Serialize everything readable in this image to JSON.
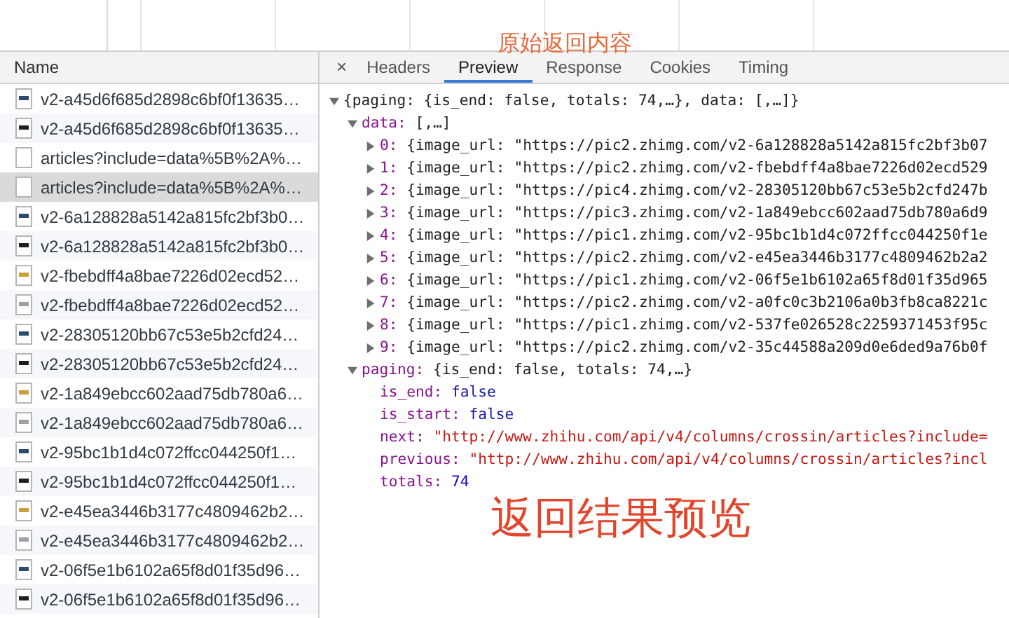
{
  "requests_header": "Name",
  "requests": [
    {
      "name": "v2-a45d6f685d2898c6bf0f13635…",
      "kind": "image",
      "selected": false
    },
    {
      "name": "v2-a45d6f685d2898c6bf0f13635…",
      "kind": "image",
      "selected": false
    },
    {
      "name": "articles?include=data%5B%2A%…",
      "kind": "document",
      "selected": false
    },
    {
      "name": "articles?include=data%5B%2A%…",
      "kind": "document",
      "selected": true
    },
    {
      "name": "v2-6a128828a5142a815fc2bf3b0…",
      "kind": "image",
      "selected": false
    },
    {
      "name": "v2-6a128828a5142a815fc2bf3b0…",
      "kind": "image",
      "selected": false
    },
    {
      "name": "v2-fbebdff4a8bae7226d02ecd52…",
      "kind": "image",
      "selected": false
    },
    {
      "name": "v2-fbebdff4a8bae7226d02ecd52…",
      "kind": "image",
      "selected": false
    },
    {
      "name": "v2-28305120bb67c53e5b2cfd24…",
      "kind": "image",
      "selected": false
    },
    {
      "name": "v2-28305120bb67c53e5b2cfd24…",
      "kind": "image",
      "selected": false
    },
    {
      "name": "v2-1a849ebcc602aad75db780a6…",
      "kind": "image",
      "selected": false
    },
    {
      "name": "v2-1a849ebcc602aad75db780a6…",
      "kind": "image",
      "selected": false
    },
    {
      "name": "v2-95bc1b1d4c072ffcc044250f1…",
      "kind": "image",
      "selected": false
    },
    {
      "name": "v2-95bc1b1d4c072ffcc044250f1…",
      "kind": "image",
      "selected": false
    },
    {
      "name": "v2-e45ea3446b3177c4809462b2…",
      "kind": "image",
      "selected": false
    },
    {
      "name": "v2-e45ea3446b3177c4809462b2…",
      "kind": "image",
      "selected": false
    },
    {
      "name": "v2-06f5e1b6102a65f8d01f35d96…",
      "kind": "image",
      "selected": false
    },
    {
      "name": "v2-06f5e1b6102a65f8d01f35d96…",
      "kind": "image",
      "selected": false
    }
  ],
  "close_tab": "×",
  "tabs": [
    {
      "label": "Headers",
      "selected": false
    },
    {
      "label": "Preview",
      "selected": true
    },
    {
      "label": "Response",
      "selected": false
    },
    {
      "label": "Cookies",
      "selected": false
    },
    {
      "label": "Timing",
      "selected": false
    }
  ],
  "preview": {
    "summary": "{paging: {is_end: false, totals: 74,…}, data: [,…]}",
    "expanded": true,
    "children": [
      {
        "key": "data:",
        "summary": "[,…]",
        "expanded": true,
        "children": [
          {
            "key": "0:",
            "summary": "{image_url: \"https://pic2.zhimg.com/v2-6a128828a5142a815fc2bf3b07",
            "expanded": false
          },
          {
            "key": "1:",
            "summary": "{image_url: \"https://pic2.zhimg.com/v2-fbebdff4a8bae7226d02ecd529",
            "expanded": false
          },
          {
            "key": "2:",
            "summary": "{image_url: \"https://pic4.zhimg.com/v2-28305120bb67c53e5b2cfd247b",
            "expanded": false
          },
          {
            "key": "3:",
            "summary": "{image_url: \"https://pic3.zhimg.com/v2-1a849ebcc602aad75db780a6d9",
            "expanded": false
          },
          {
            "key": "4:",
            "summary": "{image_url: \"https://pic1.zhimg.com/v2-95bc1b1d4c072ffcc044250f1e",
            "expanded": false
          },
          {
            "key": "5:",
            "summary": "{image_url: \"https://pic2.zhimg.com/v2-e45ea3446b3177c4809462b2a2",
            "expanded": false
          },
          {
            "key": "6:",
            "summary": "{image_url: \"https://pic1.zhimg.com/v2-06f5e1b6102a65f8d01f35d965",
            "expanded": false
          },
          {
            "key": "7:",
            "summary": "{image_url: \"https://pic2.zhimg.com/v2-a0fc0c3b2106a0b3fb8ca8221c",
            "expanded": false
          },
          {
            "key": "8:",
            "summary": "{image_url: \"https://pic1.zhimg.com/v2-537fe026528c2259371453f95c",
            "expanded": false
          },
          {
            "key": "9:",
            "summary": "{image_url: \"https://pic2.zhimg.com/v2-35c44588a209d0e6ded9a76b0f",
            "expanded": false
          }
        ]
      },
      {
        "key": "paging:",
        "summary": "{is_end: false, totals: 74,…}",
        "expanded": true,
        "children": [
          {
            "key": "is_end:",
            "value": "false",
            "kind": "bool"
          },
          {
            "key": "is_start:",
            "value": "false",
            "kind": "bool"
          },
          {
            "key": "next:",
            "value": "\"http://www.zhihu.com/api/v4/columns/crossin/articles?include=",
            "kind": "string"
          },
          {
            "key": "previous:",
            "value": "\"http://www.zhihu.com/api/v4/columns/crossin/articles?incl",
            "kind": "string"
          },
          {
            "key": "totals:",
            "value": "74",
            "kind": "number"
          }
        ]
      }
    ]
  },
  "annotations": [
    {
      "text": "原始返回内容",
      "kind": "small"
    },
    {
      "text": "返回结果预览",
      "kind": "large"
    }
  ]
}
